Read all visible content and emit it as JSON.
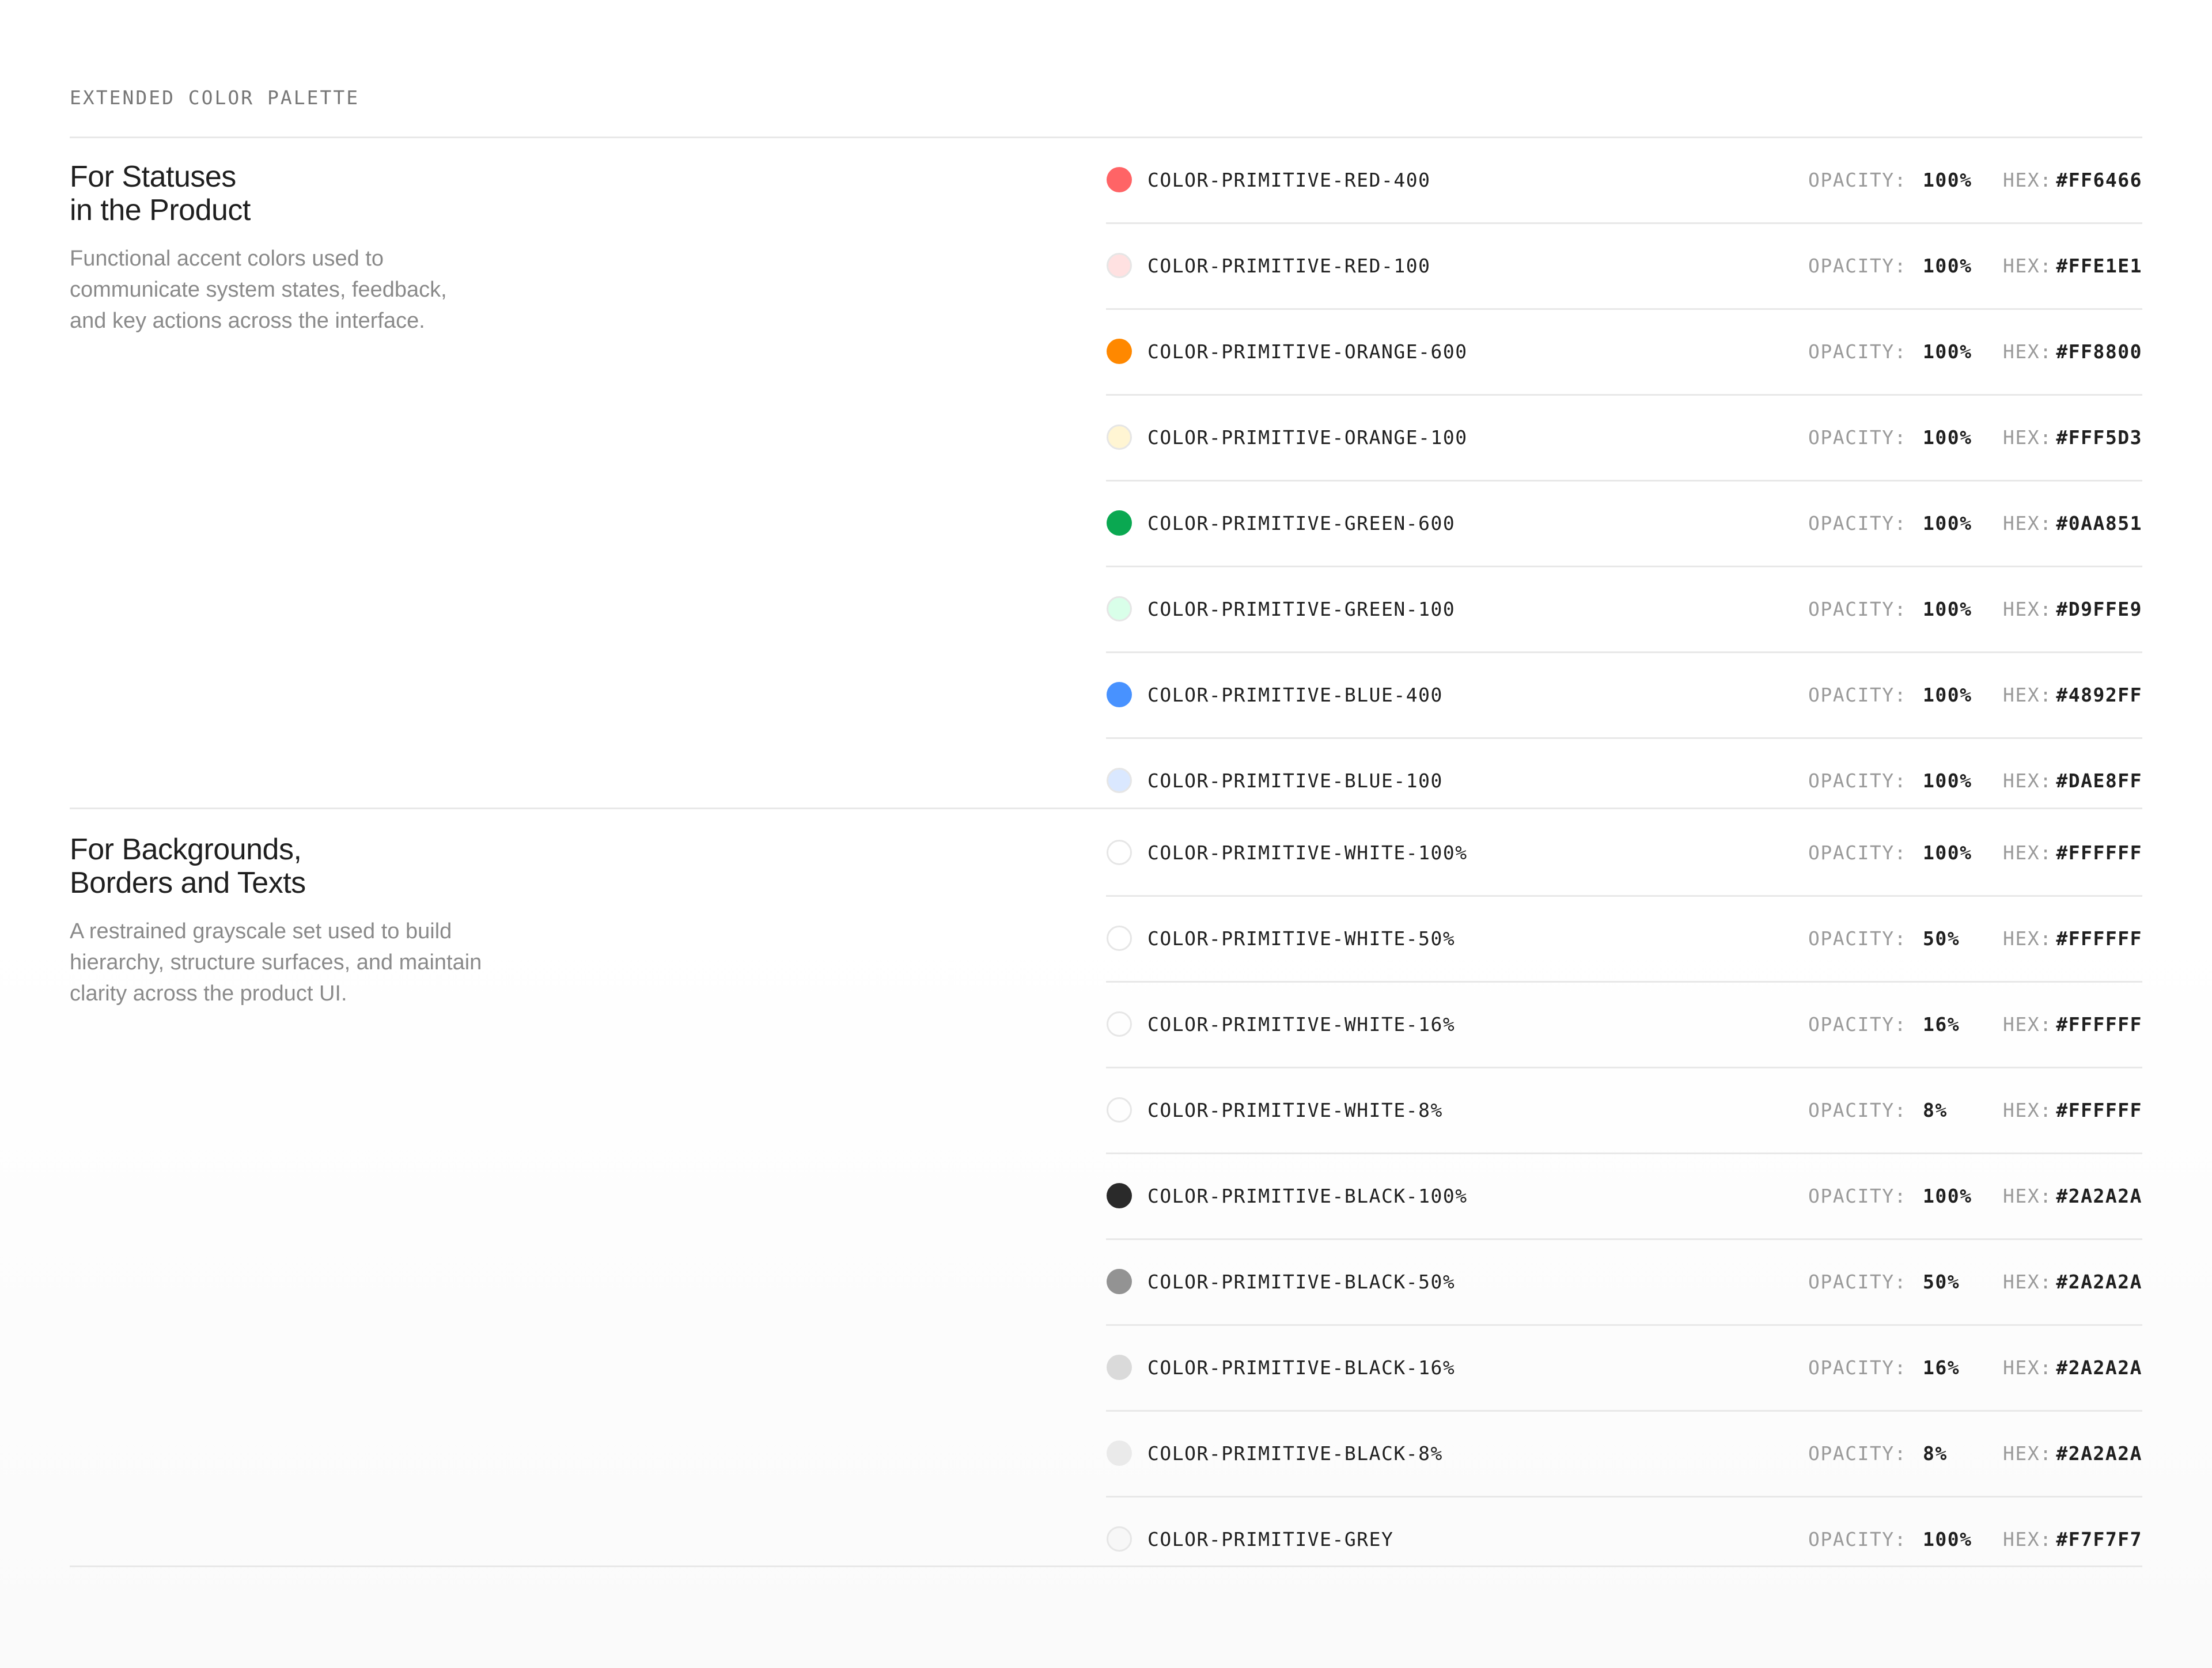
{
  "header": {
    "eyebrow": "EXTENDED COLOR PALETTE"
  },
  "labels": {
    "opacity": "OPACITY:",
    "hex": "HEX:"
  },
  "sections": [
    {
      "title_lines": [
        "For Statuses",
        "in the Product"
      ],
      "description_lines": [
        "Functional accent colors used to",
        "communicate system states, feedback,",
        "and key actions across the interface."
      ],
      "rows": [
        {
          "token": "COLOR-PRIMITIVE-RED-400",
          "opacity": "100%",
          "hex": "#FF6466",
          "swatch_color": "#FF6466",
          "swatch_opacity": 1,
          "outlined": false
        },
        {
          "token": "COLOR-PRIMITIVE-RED-100",
          "opacity": "100%",
          "hex": "#FFE1E1",
          "swatch_color": "#FFE1E1",
          "swatch_opacity": 1,
          "outlined": true
        },
        {
          "token": "COLOR-PRIMITIVE-ORANGE-600",
          "opacity": "100%",
          "hex": "#FF8800",
          "swatch_color": "#FF8800",
          "swatch_opacity": 1,
          "outlined": false
        },
        {
          "token": "COLOR-PRIMITIVE-ORANGE-100",
          "opacity": "100%",
          "hex": "#FFF5D3",
          "swatch_color": "#FFF5D3",
          "swatch_opacity": 1,
          "outlined": true
        },
        {
          "token": "COLOR-PRIMITIVE-GREEN-600",
          "opacity": "100%",
          "hex": "#0AA851",
          "swatch_color": "#0AA851",
          "swatch_opacity": 1,
          "outlined": false
        },
        {
          "token": "COLOR-PRIMITIVE-GREEN-100",
          "opacity": "100%",
          "hex": "#D9FFE9",
          "swatch_color": "#D9FFE9",
          "swatch_opacity": 1,
          "outlined": true
        },
        {
          "token": "COLOR-PRIMITIVE-BLUE-400",
          "opacity": "100%",
          "hex": "#4892FF",
          "swatch_color": "#4892FF",
          "swatch_opacity": 1,
          "outlined": false
        },
        {
          "token": "COLOR-PRIMITIVE-BLUE-100",
          "opacity": "100%",
          "hex": "#DAE8FF",
          "swatch_color": "#DAE8FF",
          "swatch_opacity": 1,
          "outlined": true
        }
      ]
    },
    {
      "title_lines": [
        "For Backgrounds,",
        "Borders and Texts"
      ],
      "description_lines": [
        "A restrained grayscale set used to build",
        "hierarchy, structure surfaces, and maintain",
        "clarity across the product UI."
      ],
      "rows": [
        {
          "token": "COLOR-PRIMITIVE-WHITE-100%",
          "opacity": "100%",
          "hex": "#FFFFFF",
          "swatch_color": "#FFFFFF",
          "swatch_opacity": 1,
          "outlined": true
        },
        {
          "token": "COLOR-PRIMITIVE-WHITE-50%",
          "opacity": "50%",
          "hex": "#FFFFFF",
          "swatch_color": "#FFFFFF",
          "swatch_opacity": 0.5,
          "outlined": true
        },
        {
          "token": "COLOR-PRIMITIVE-WHITE-16%",
          "opacity": "16%",
          "hex": "#FFFFFF",
          "swatch_color": "#FFFFFF",
          "swatch_opacity": 0.16,
          "outlined": true
        },
        {
          "token": "COLOR-PRIMITIVE-WHITE-8%",
          "opacity": "8%",
          "hex": "#FFFFFF",
          "swatch_color": "#FFFFFF",
          "swatch_opacity": 0.08,
          "outlined": true
        },
        {
          "token": "COLOR-PRIMITIVE-BLACK-100%",
          "opacity": "100%",
          "hex": "#2A2A2A",
          "swatch_color": "#2A2A2A",
          "swatch_opacity": 1,
          "outlined": false
        },
        {
          "token": "COLOR-PRIMITIVE-BLACK-50%",
          "opacity": "50%",
          "hex": "#2A2A2A",
          "swatch_color": "#2A2A2A",
          "swatch_opacity": 0.5,
          "outlined": false
        },
        {
          "token": "COLOR-PRIMITIVE-BLACK-16%",
          "opacity": "16%",
          "hex": "#2A2A2A",
          "swatch_color": "#2A2A2A",
          "swatch_opacity": 0.16,
          "outlined": false
        },
        {
          "token": "COLOR-PRIMITIVE-BLACK-8%",
          "opacity": "8%",
          "hex": "#2A2A2A",
          "swatch_color": "#2A2A2A",
          "swatch_opacity": 0.08,
          "outlined": false
        },
        {
          "token": "COLOR-PRIMITIVE-GREY",
          "opacity": "100%",
          "hex": "#F7F7F7",
          "swatch_color": "#F7F7F7",
          "swatch_opacity": 1,
          "outlined": true
        }
      ]
    }
  ]
}
